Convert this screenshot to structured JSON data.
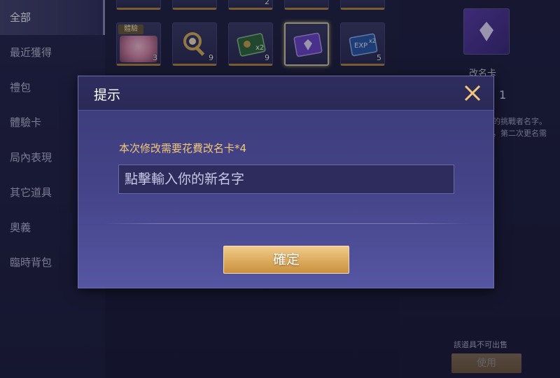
{
  "sidebar": {
    "items": [
      {
        "label": "全部",
        "active": true
      },
      {
        "label": "最近獲得",
        "active": false
      },
      {
        "label": "禮包",
        "active": false
      },
      {
        "label": "體驗卡",
        "active": false
      },
      {
        "label": "局內表現",
        "active": false
      },
      {
        "label": "其它道具",
        "active": false
      },
      {
        "label": "奧義",
        "active": false
      },
      {
        "label": "臨時背包",
        "active": false
      }
    ]
  },
  "grid": {
    "top_row_counts": [
      "",
      "",
      "2",
      "",
      ""
    ],
    "items": [
      {
        "icon": "hero-portrait-icon",
        "badge": "體驗",
        "count": "3"
      },
      {
        "icon": "golden-key-icon",
        "count": "9"
      },
      {
        "icon": "green-ticket-icon",
        "count": "9"
      },
      {
        "icon": "rename-card-icon",
        "count": "",
        "selected": true
      },
      {
        "icon": "exp-card-icon",
        "count": "5"
      }
    ]
  },
  "detail": {
    "name": "改名卡",
    "quantity": "1",
    "desc_line1": "的挑戰者名字。",
    "desc_line2": "，第二次更名需",
    "not_sellable": "該道具不可出售",
    "use_label": "使用"
  },
  "dialog": {
    "title": "提示",
    "message": "本次修改需要花費改名卡*4",
    "input_placeholder": "點擊輸入你的新名字",
    "input_value": "",
    "confirm_label": "確定"
  },
  "colors": {
    "accent_gold": "#dcaa5e",
    "message_gold": "#f1c879",
    "dialog_bg": "#45448a",
    "sidebar_bg": "#25264a"
  }
}
